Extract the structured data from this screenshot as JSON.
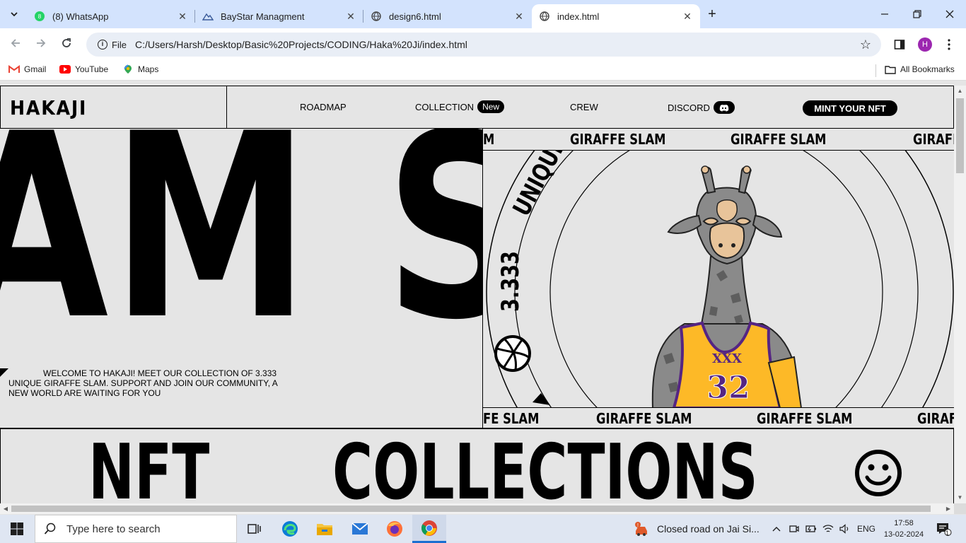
{
  "browser": {
    "tabs": [
      {
        "title": "(8) WhatsApp",
        "icon": "whatsapp-icon",
        "active": false
      },
      {
        "title": "BayStar Managment",
        "icon": "baystar-icon",
        "active": false
      },
      {
        "title": "design6.html",
        "icon": "globe-icon",
        "active": false
      },
      {
        "title": "index.html",
        "icon": "globe-icon",
        "active": true
      }
    ],
    "address": {
      "chip_label": "File",
      "url": "C:/Users/Harsh/Desktop/Basic%20Projects/CODING/Haka%20Ji/index.html"
    },
    "profile_initial": "H",
    "bookmarks": [
      {
        "label": "Gmail",
        "icon": "gmail-icon"
      },
      {
        "label": "YouTube",
        "icon": "youtube-icon"
      },
      {
        "label": "Maps",
        "icon": "maps-icon"
      }
    ],
    "all_bookmarks_label": "All Bookmarks"
  },
  "site": {
    "logo": "HAKAJI",
    "nav": {
      "roadmap": "ROADMAP",
      "collection": "COLLECTION",
      "collection_badge": "New",
      "crew": "CREW",
      "discord": "DISCORD",
      "mint_button": "MINT YOUR NFT"
    },
    "hero": {
      "big_text": "AM SL",
      "welcome": "WELCOME TO HAKAJI! MEET OUR COLLECTION OF 3.333 UNIQUE GIRAFFE SLAM. SUPPORT AND JOIN OUR COMMUNITY, A NEW WORLD ARE WAITING FOR YOU",
      "marquee_top": [
        "M",
        "GIRAFFE SLAM",
        "GIRAFFE SLAM",
        "GIRAFF"
      ],
      "marquee_bottom": [
        "FE SLAM",
        "GIRAFFE SLAM",
        "GIRAFFE SLAM",
        "GIRAF"
      ],
      "circle_text_1": "UNIQUE",
      "circle_text_2": "3.333",
      "jersey_text": "XXX",
      "jersey_number": "32"
    },
    "collections": {
      "word_1": "NFT",
      "word_2": "COLLECTIONS"
    }
  },
  "taskbar": {
    "search_placeholder": "Type here to search",
    "weather_notice": "Closed road on Jai Si...",
    "language": "ENG",
    "time": "17:58",
    "date": "13-02-2024",
    "notification_count": "1"
  }
}
